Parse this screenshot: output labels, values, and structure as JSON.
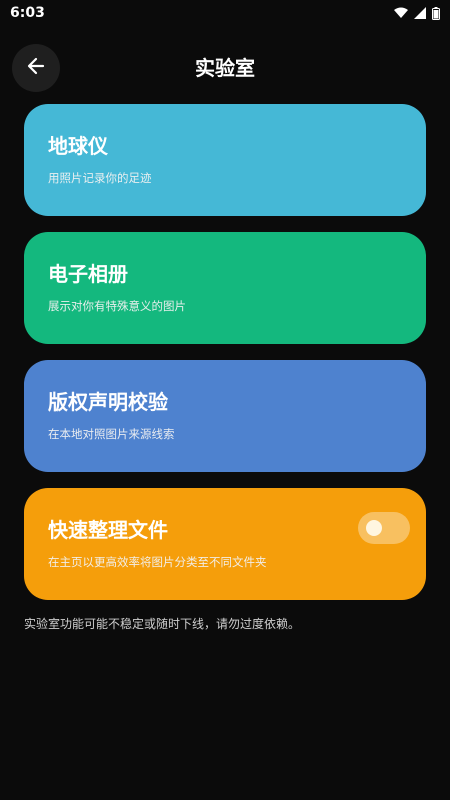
{
  "status_bar": {
    "time": "6:03",
    "icons": [
      "wifi-icon",
      "cellular-signal-icon",
      "battery-icon"
    ]
  },
  "header": {
    "title": "实验室",
    "back_icon": "arrow-left-icon"
  },
  "cards": [
    {
      "title": "地球仪",
      "subtitle": "用照片记录你的足迹",
      "color": "#45b8d6"
    },
    {
      "title": "电子相册",
      "subtitle": "展示对你有特殊意义的图片",
      "color": "#14b87e"
    },
    {
      "title": "版权声明校验",
      "subtitle": "在本地对照图片来源线索",
      "color": "#4e82cf"
    },
    {
      "title": "快速整理文件",
      "subtitle": "在主页以更高效率将图片分类至不同文件夹",
      "color": "#f59e0b",
      "toggle_on": false
    }
  ],
  "footnote": "实验室功能可能不稳定或随时下线，请勿过度依赖。"
}
